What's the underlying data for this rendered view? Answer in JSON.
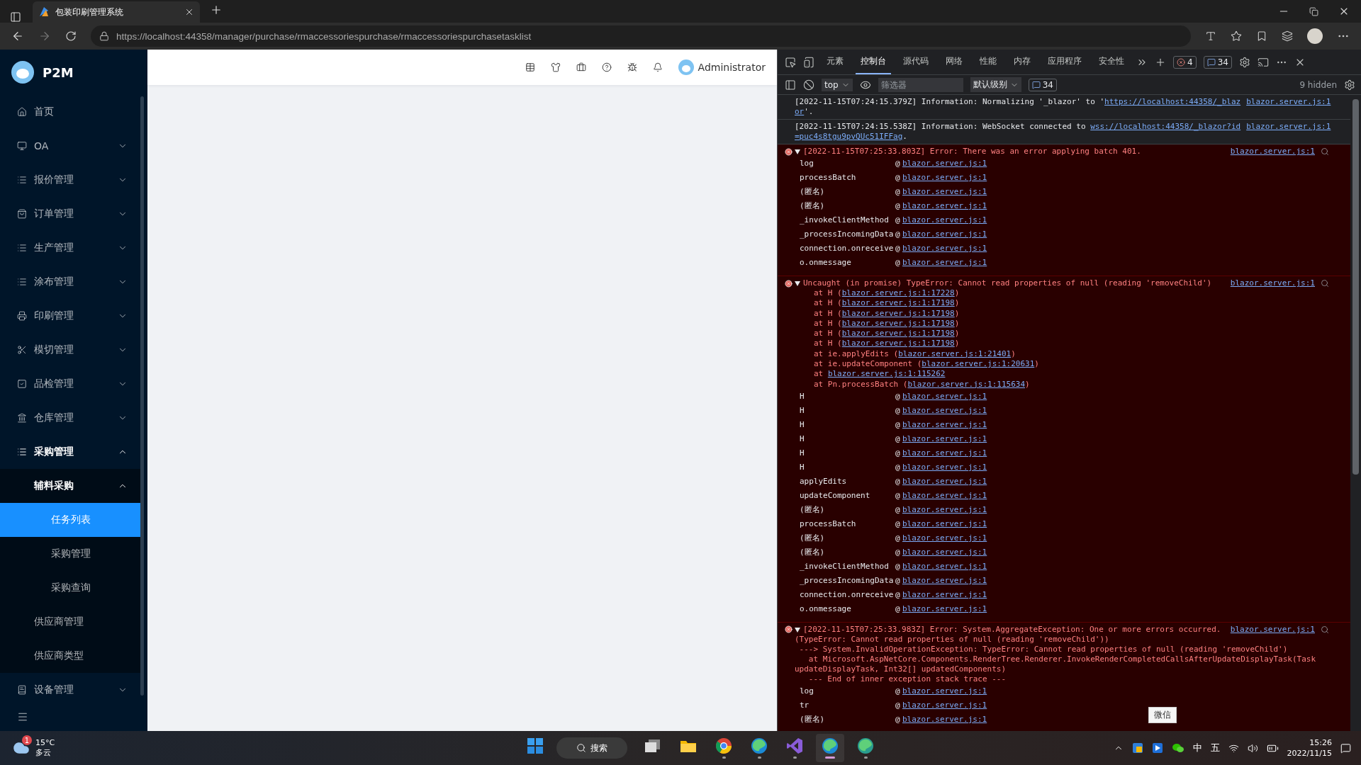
{
  "browser": {
    "tab_title": "包装印刷管理系统",
    "url": "https://localhost:44358/manager/purchase/rmaccessoriespurchase/rmaccessoriespurchasetasklist"
  },
  "app": {
    "logo_text": "P2M",
    "user_name": "Administrator",
    "menu": [
      {
        "label": "首页",
        "kind": "link",
        "selected": false
      },
      {
        "label": "OA",
        "kind": "submenu",
        "expanded": false
      },
      {
        "label": "报价管理",
        "kind": "submenu",
        "expanded": false
      },
      {
        "label": "订单管理",
        "kind": "submenu",
        "expanded": false
      },
      {
        "label": "生产管理",
        "kind": "submenu",
        "expanded": false
      },
      {
        "label": "涂布管理",
        "kind": "submenu",
        "expanded": false
      },
      {
        "label": "印刷管理",
        "kind": "submenu",
        "expanded": false
      },
      {
        "label": "模切管理",
        "kind": "submenu",
        "expanded": false
      },
      {
        "label": "品检管理",
        "kind": "submenu",
        "expanded": false
      },
      {
        "label": "仓库管理",
        "kind": "submenu",
        "expanded": false
      },
      {
        "label": "采购管理",
        "kind": "submenu",
        "expanded": true,
        "children": [
          {
            "label": "辅料采购",
            "kind": "submenu",
            "expanded": true,
            "children": [
              {
                "label": "任务列表",
                "kind": "link",
                "selected": true
              },
              {
                "label": "采购管理",
                "kind": "link",
                "selected": false
              },
              {
                "label": "采购查询",
                "kind": "link",
                "selected": false
              }
            ]
          },
          {
            "label": "供应商管理",
            "kind": "link",
            "selected": false
          },
          {
            "label": "供应商类型",
            "kind": "link",
            "selected": false
          }
        ]
      },
      {
        "label": "设备管理",
        "kind": "submenu",
        "expanded": false
      }
    ]
  },
  "devtools": {
    "tabs": [
      {
        "label": "元素",
        "selected": false
      },
      {
        "label": "控制台",
        "selected": true
      },
      {
        "label": "源代码",
        "selected": false
      },
      {
        "label": "网络",
        "selected": false
      },
      {
        "label": "性能",
        "selected": false
      },
      {
        "label": "内存",
        "selected": false
      },
      {
        "label": "应用程序",
        "selected": false
      },
      {
        "label": "安全性",
        "selected": false
      }
    ],
    "error_count": "4",
    "message_count": "34",
    "context": "top",
    "filter": {
      "placeholder": "筛选器"
    },
    "level_filter": "默认级别",
    "filter_message_count": "34",
    "hidden_count": "9 hidden",
    "messages": [
      {
        "kind": "info",
        "lines": [
          [
            {
              "text": "[2022-11-15T07:24:15.379Z] Information: Normalizing '_blazor' to '"
            },
            {
              "link": "https://localhost:44358/_blaz"
            }
          ],
          [
            {
              "link": "or"
            },
            {
              "text": "'."
            }
          ]
        ],
        "source": "blazor.server.js:1"
      },
      {
        "kind": "info",
        "lines": [
          [
            {
              "text": "[2022-11-15T07:24:15.538Z] Information: WebSocket connected to "
            },
            {
              "link": "wss://localhost:44358/_blazor?id"
            }
          ],
          [
            {
              "link": "=puc4s8tgu9pvQUc51IFFag"
            },
            {
              "text": "."
            }
          ]
        ],
        "source": "blazor.server.js:1"
      },
      {
        "kind": "error",
        "expanded": true,
        "lines": [
          [
            {
              "text": "[2022-11-15T07:25:33.803Z] Error: There was an error applying batch 401."
            }
          ]
        ],
        "source": "blazor.server.js:1",
        "stack": [
          {
            "fn": "log",
            "at": "@",
            "link": "blazor.server.js:1"
          },
          {
            "fn": "processBatch",
            "at": "@",
            "link": "blazor.server.js:1"
          },
          {
            "fn": "(匿名)",
            "at": "@",
            "link": "blazor.server.js:1"
          },
          {
            "fn": "(匿名)",
            "at": "@",
            "link": "blazor.server.js:1"
          },
          {
            "fn": "_invokeClientMethod",
            "at": "@",
            "link": "blazor.server.js:1"
          },
          {
            "fn": "_processIncomingData",
            "at": "@",
            "link": "blazor.server.js:1"
          },
          {
            "fn": "connection.onreceive",
            "at": "@",
            "link": "blazor.server.js:1"
          },
          {
            "fn": "o.onmessage",
            "at": "@",
            "link": "blazor.server.js:1"
          }
        ]
      },
      {
        "kind": "error",
        "expanded": true,
        "lines": [
          [
            {
              "text": "Uncaught (in promise) TypeError: Cannot read properties of null (reading 'removeChild')"
            }
          ]
        ],
        "source": "blazor.server.js:1",
        "trace": [
          {
            "text": "at H (",
            "link": "blazor.server.js:1:17228",
            "end": ")"
          },
          {
            "text": "at H (",
            "link": "blazor.server.js:1:17198",
            "end": ")"
          },
          {
            "text": "at H (",
            "link": "blazor.server.js:1:17198",
            "end": ")"
          },
          {
            "text": "at H (",
            "link": "blazor.server.js:1:17198",
            "end": ")"
          },
          {
            "text": "at H (",
            "link": "blazor.server.js:1:17198",
            "end": ")"
          },
          {
            "text": "at H (",
            "link": "blazor.server.js:1:17198",
            "end": ")"
          },
          {
            "text": "at ie.applyEdits (",
            "link": "blazor.server.js:1:21401",
            "end": ")"
          },
          {
            "text": "at ie.updateComponent (",
            "link": "blazor.server.js:1:20631",
            "end": ")"
          },
          {
            "text": "at ",
            "link": "blazor.server.js:1:115262"
          },
          {
            "text": "at Pn.processBatch (",
            "link": "blazor.server.js:1:115634",
            "end": ")"
          }
        ],
        "stack": [
          {
            "fn": "H",
            "at": "@",
            "link": "blazor.server.js:1"
          },
          {
            "fn": "H",
            "at": "@",
            "link": "blazor.server.js:1"
          },
          {
            "fn": "H",
            "at": "@",
            "link": "blazor.server.js:1"
          },
          {
            "fn": "H",
            "at": "@",
            "link": "blazor.server.js:1"
          },
          {
            "fn": "H",
            "at": "@",
            "link": "blazor.server.js:1"
          },
          {
            "fn": "H",
            "at": "@",
            "link": "blazor.server.js:1"
          },
          {
            "fn": "applyEdits",
            "at": "@",
            "link": "blazor.server.js:1"
          },
          {
            "fn": "updateComponent",
            "at": "@",
            "link": "blazor.server.js:1"
          },
          {
            "fn": "(匿名)",
            "at": "@",
            "link": "blazor.server.js:1"
          },
          {
            "fn": "processBatch",
            "at": "@",
            "link": "blazor.server.js:1"
          },
          {
            "fn": "(匿名)",
            "at": "@",
            "link": "blazor.server.js:1"
          },
          {
            "fn": "(匿名)",
            "at": "@",
            "link": "blazor.server.js:1"
          },
          {
            "fn": "_invokeClientMethod",
            "at": "@",
            "link": "blazor.server.js:1"
          },
          {
            "fn": "_processIncomingData",
            "at": "@",
            "link": "blazor.server.js:1"
          },
          {
            "fn": "connection.onreceive",
            "at": "@",
            "link": "blazor.server.js:1"
          },
          {
            "fn": "o.onmessage",
            "at": "@",
            "link": "blazor.server.js:1"
          }
        ]
      },
      {
        "kind": "error",
        "expanded": true,
        "lines": [
          [
            {
              "text": "[2022-11-15T07:25:33.983Z] Error: System.AggregateException: One or more errors occurred."
            }
          ],
          [
            {
              "text": "(TypeError: Cannot read properties of null (reading 'removeChild'))"
            }
          ],
          [
            {
              "text": " ---> System.InvalidOperationException: TypeError: Cannot read properties of null (reading 'removeChild')"
            }
          ],
          [
            {
              "text": "   at Microsoft.AspNetCore.Components.RenderTree.Renderer.InvokeRenderCompletedCallsAfterUpdateDisplayTask(Task"
            }
          ],
          [
            {
              "text": "updateDisplayTask, Int32[] updatedComponents)"
            }
          ],
          [
            {
              "text": "   --- End of inner exception stack trace ---"
            }
          ]
        ],
        "source": "blazor.server.js:1",
        "stack": [
          {
            "fn": "log",
            "at": "@",
            "link": "blazor.server.js:1"
          },
          {
            "fn": "tr",
            "at": "@",
            "link": "blazor.server.js:1"
          },
          {
            "fn": "(匿名)",
            "at": "@",
            "link": "blazor.server.js:1"
          }
        ]
      }
    ]
  },
  "tooltip": "微信",
  "taskbar": {
    "weather_badge": "1",
    "temperature": "15°C",
    "weather": "多云",
    "search": "搜索",
    "apps": [
      {
        "running": false,
        "active": false
      },
      {
        "running": false,
        "active": false
      },
      {
        "running": false,
        "active": false
      },
      {
        "running": true,
        "active": false
      },
      {
        "running": true,
        "active": false
      },
      {
        "running": true,
        "active": false
      },
      {
        "running": true,
        "active": true
      },
      {
        "running": true,
        "active": false
      }
    ],
    "ime_mode": "中",
    "ime_layout": "五",
    "time": "15:26",
    "date": "2022/11/15"
  }
}
